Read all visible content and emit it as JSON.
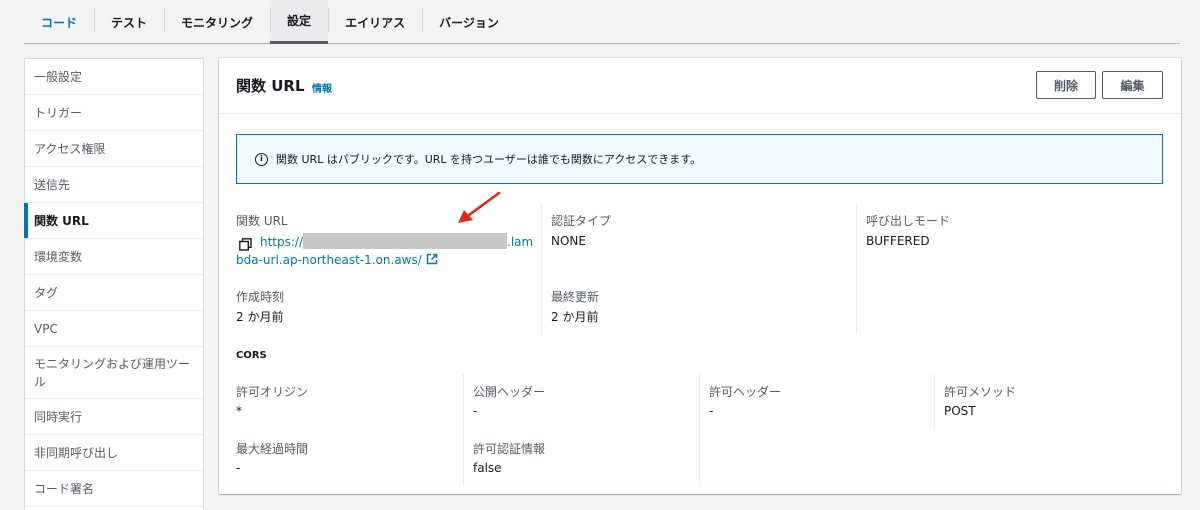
{
  "tabs": [
    {
      "label": "コード",
      "link": true
    },
    {
      "label": "テスト"
    },
    {
      "label": "モニタリング"
    },
    {
      "label": "設定",
      "active": true
    },
    {
      "label": "エイリアス"
    },
    {
      "label": "バージョン"
    }
  ],
  "sidebar": {
    "items": [
      {
        "label": "一般設定"
      },
      {
        "label": "トリガー"
      },
      {
        "label": "アクセス権限"
      },
      {
        "label": "送信先"
      },
      {
        "label": "関数 URL",
        "active": true
      },
      {
        "label": "環境変数"
      },
      {
        "label": "タグ"
      },
      {
        "label": "VPC"
      },
      {
        "label": "モニタリングおよび運用ツール"
      },
      {
        "label": "同時実行"
      },
      {
        "label": "非同期呼び出し"
      },
      {
        "label": "コード署名"
      }
    ]
  },
  "panel": {
    "title": "関数 URL",
    "info_link": "情報",
    "delete_label": "削除",
    "edit_label": "編集",
    "alert_text": "関数 URL はパブリックです。URL を持つユーザーは誰でも関数にアクセスできます。",
    "fields": {
      "function_url_label": "関数 URL",
      "function_url_prefix": "https://",
      "function_url_line1_suffix": ".lam",
      "function_url_line2": "bda-url.ap-northeast-1.on.aws/",
      "auth_type_label": "認証タイプ",
      "auth_type_value": "NONE",
      "invoke_mode_label": "呼び出しモード",
      "invoke_mode_value": "BUFFERED",
      "created_label": "作成時刻",
      "created_value": "2 か月前",
      "updated_label": "最終更新",
      "updated_value": "2 か月前"
    },
    "cors": {
      "title": "CORS",
      "allow_origins_label": "許可オリジン",
      "allow_origins_value": "*",
      "expose_headers_label": "公開ヘッダー",
      "expose_headers_value": "-",
      "allow_headers_label": "許可ヘッダー",
      "allow_headers_value": "-",
      "allow_methods_label": "許可メソッド",
      "allow_methods_value": "POST",
      "max_age_label": "最大経過時間",
      "max_age_value": "-",
      "allow_credentials_label": "許可認証情報",
      "allow_credentials_value": "false"
    }
  },
  "colors": {
    "link": "#0073bb",
    "accent_arrow": "#e8231c",
    "alert_border": "#0073bb",
    "alert_bg": "#f1faff"
  }
}
